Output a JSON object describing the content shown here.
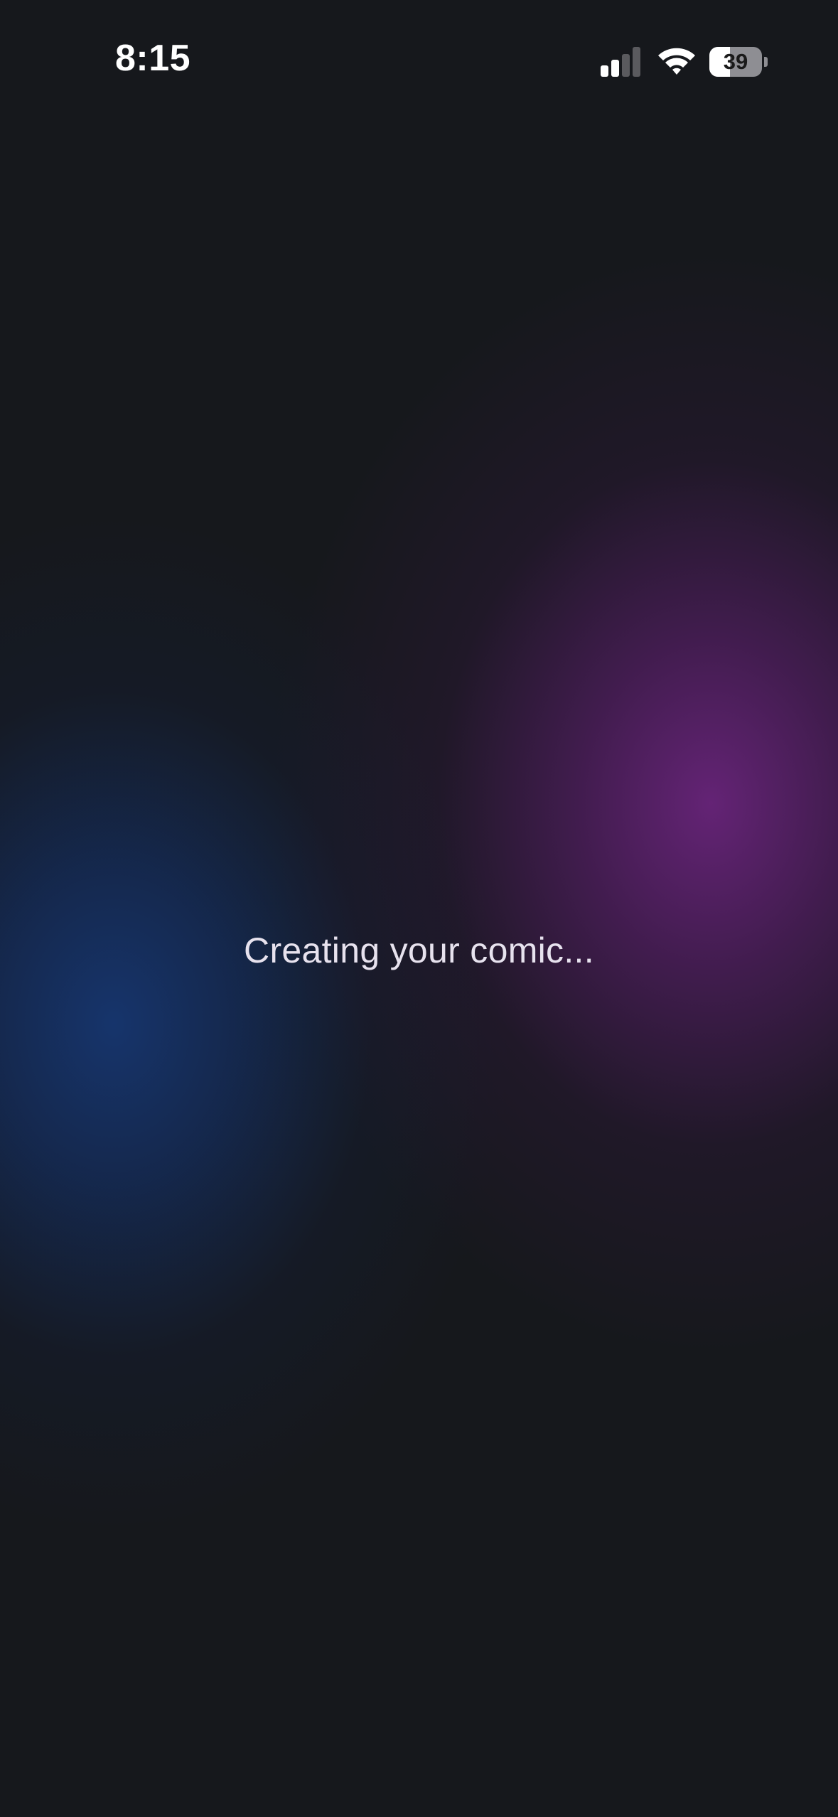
{
  "status_bar": {
    "time": "8:15",
    "signal_bars_active": 2,
    "signal_bars_total": 4,
    "battery_level": 39,
    "battery_label": "39",
    "icons": [
      "cellular-signal-icon",
      "wifi-icon",
      "battery-icon"
    ]
  },
  "main": {
    "loading_text": "Creating your comic..."
  },
  "colors": {
    "background": "#16181c",
    "glow_purple": "#68247a",
    "glow_blue": "#163670",
    "text": "#e7e2ee"
  }
}
